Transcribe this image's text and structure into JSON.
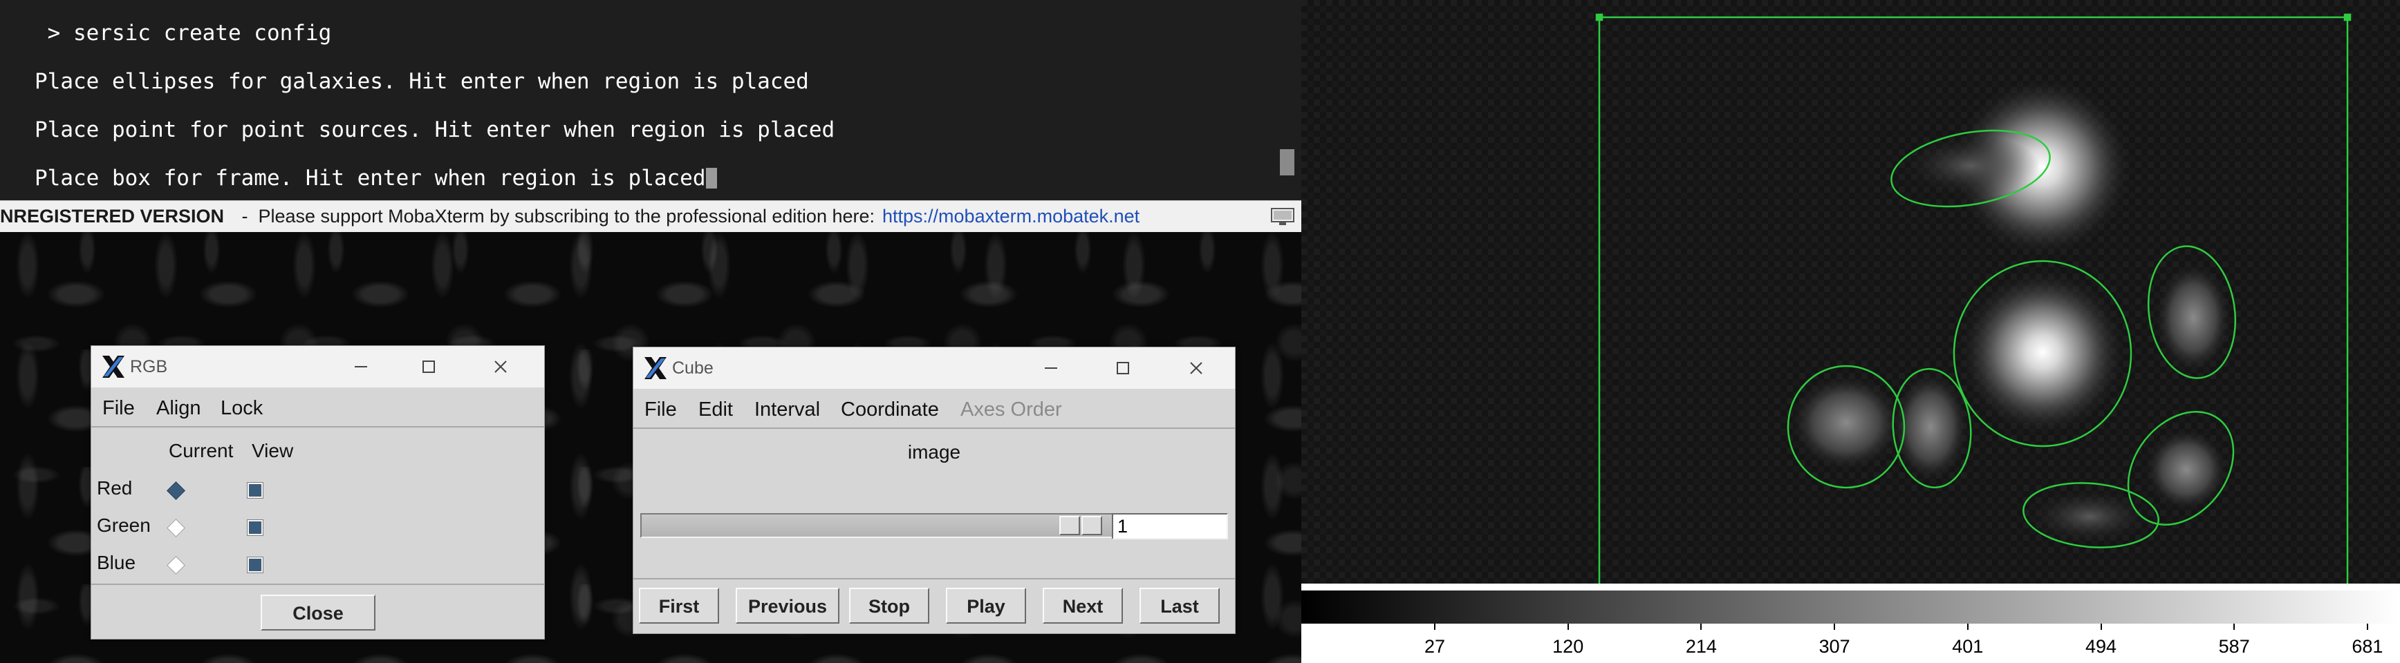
{
  "terminal": {
    "lines": [
      " > sersic create config",
      "Place ellipses for galaxies. Hit enter when region is placed",
      "Place point for point sources. Hit enter when region is placed",
      "Place box for frame. Hit enter when region is placed"
    ]
  },
  "banner": {
    "unregistered": "NREGISTERED VERSION",
    "message": " -  Please support MobaXterm by subscribing to the professional edition here:",
    "link": "https://mobaxterm.mobatek.net"
  },
  "rgb_window": {
    "title": "RGB",
    "menu": [
      "File",
      "Align",
      "Lock"
    ],
    "headers": {
      "current": "Current",
      "view": "View"
    },
    "channels": [
      {
        "name": "Red",
        "current": true,
        "view": true
      },
      {
        "name": "Green",
        "current": false,
        "view": true
      },
      {
        "name": "Blue",
        "current": false,
        "view": true
      }
    ],
    "close_label": "Close"
  },
  "cube_window": {
    "title": "Cube",
    "menu": [
      "File",
      "Edit",
      "Interval",
      "Coordinate",
      "Axes Order"
    ],
    "menu_disabled": [
      "Axes Order"
    ],
    "label": "image",
    "slice_value": "1",
    "buttons": [
      "First",
      "Previous",
      "Stop",
      "Play",
      "Next",
      "Last"
    ]
  },
  "ds9": {
    "region_color": "#2ecc40",
    "colorbar_ticks": [
      "27",
      "120",
      "214",
      "307",
      "401",
      "494",
      "587",
      "681"
    ]
  },
  "icons": [
    "x-logo-icon",
    "minimize-icon",
    "maximize-icon",
    "close-icon",
    "monitor-icon"
  ]
}
